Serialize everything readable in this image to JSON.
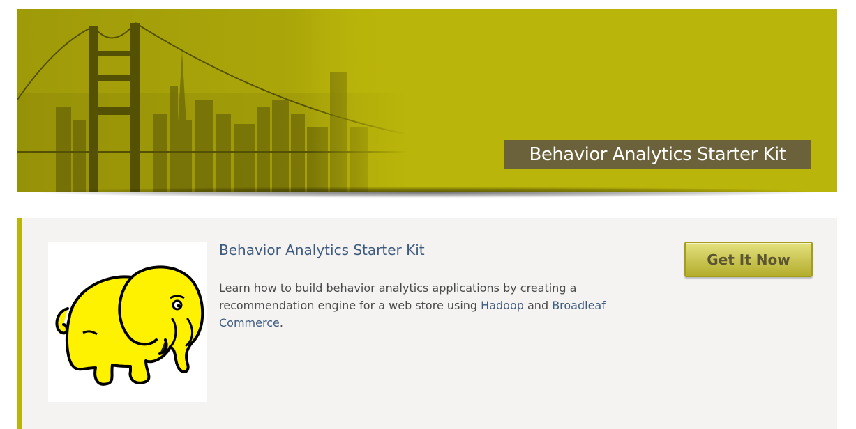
{
  "banner": {
    "title": "Behavior Analytics Starter Kit",
    "background_color": "#bab50a",
    "title_box_color": "#6b623c",
    "image": "golden-gate-bridge-city-skyline"
  },
  "card": {
    "accent_color": "#bab50a",
    "image": "hadoop-yellow-elephant-logo",
    "title": "Behavior Analytics Starter Kit",
    "description_part1": "Learn how to build behavior analytics applications by creating a recommendation engine for a web store using ",
    "link1": "Hadoop",
    "description_part2": " and ",
    "link2": "Broadleaf Commerce",
    "description_part3": ".",
    "cta_label": "Get It Now"
  }
}
